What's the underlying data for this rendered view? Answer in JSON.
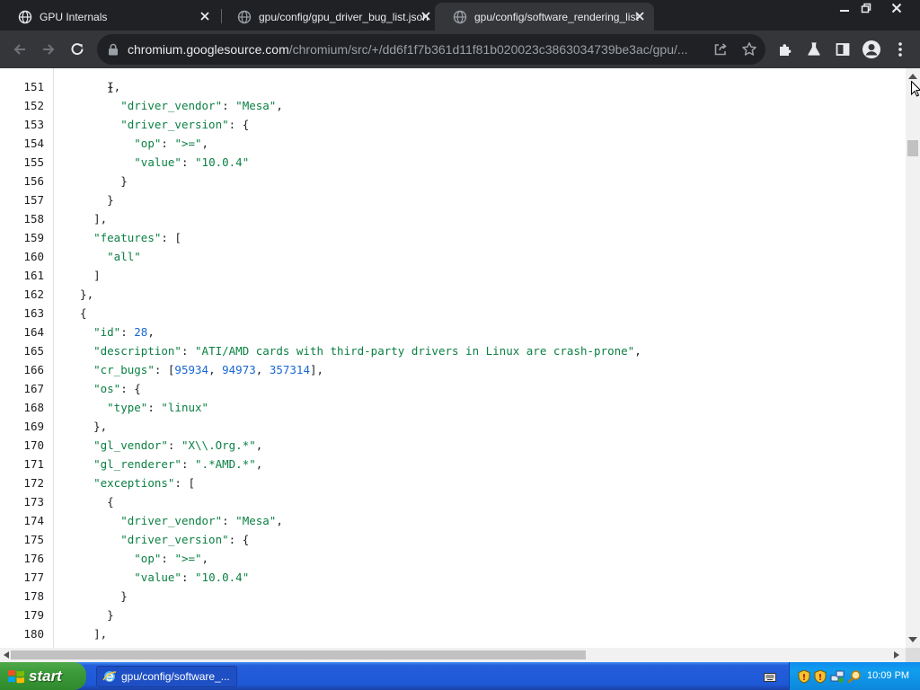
{
  "tabs": [
    {
      "title": "GPU Internals",
      "active": false
    },
    {
      "title": "gpu/config/gpu_driver_bug_list.json",
      "active": false
    },
    {
      "title": "gpu/config/software_rendering_list",
      "active": true
    }
  ],
  "omnibox": {
    "host": "chromium.googlesource.com",
    "path": "/chromium/src/+/dd6f1f7b361d11f81b020023c3863034739be3ac/gpu/..."
  },
  "code_lines": [
    {
      "num": "151",
      "text": "      {"
    },
    {
      "num": "152",
      "text": "        \"driver_vendor\": \"Mesa\","
    },
    {
      "num": "153",
      "text": "        \"driver_version\": {"
    },
    {
      "num": "154",
      "text": "          \"op\": \">=\","
    },
    {
      "num": "155",
      "text": "          \"value\": \"10.0.4\""
    },
    {
      "num": "156",
      "text": "        }"
    },
    {
      "num": "157",
      "text": "      }"
    },
    {
      "num": "158",
      "text": "    ],"
    },
    {
      "num": "159",
      "text": "    \"features\": ["
    },
    {
      "num": "160",
      "text": "      \"all\""
    },
    {
      "num": "161",
      "text": "    ]"
    },
    {
      "num": "162",
      "text": "  },"
    },
    {
      "num": "163",
      "text": "  {"
    },
    {
      "num": "164",
      "text": "    \"id\": 28,"
    },
    {
      "num": "165",
      "text": "    \"description\": \"ATI/AMD cards with third-party drivers in Linux are crash-prone\","
    },
    {
      "num": "166",
      "text": "    \"cr_bugs\": [95934, 94973, 357314],"
    },
    {
      "num": "167",
      "text": "    \"os\": {"
    },
    {
      "num": "168",
      "text": "      \"type\": \"linux\""
    },
    {
      "num": "169",
      "text": "    },"
    },
    {
      "num": "170",
      "text": "    \"gl_vendor\": \"X\\\\.Org.*\","
    },
    {
      "num": "171",
      "text": "    \"gl_renderer\": \".*AMD.*\","
    },
    {
      "num": "172",
      "text": "    \"exceptions\": ["
    },
    {
      "num": "173",
      "text": "      {"
    },
    {
      "num": "174",
      "text": "        \"driver_vendor\": \"Mesa\","
    },
    {
      "num": "175",
      "text": "        \"driver_version\": {"
    },
    {
      "num": "176",
      "text": "          \"op\": \">=\","
    },
    {
      "num": "177",
      "text": "          \"value\": \"10.0.4\""
    },
    {
      "num": "178",
      "text": "        }"
    },
    {
      "num": "179",
      "text": "      }"
    },
    {
      "num": "180",
      "text": "    ],"
    }
  ],
  "taskbar": {
    "start_label": "start",
    "task_item": "gpu/config/software_...",
    "clock": "10:09 PM"
  },
  "colors": {
    "json_string": "#0b8043",
    "json_number": "#1967d2",
    "chrome_dark": "#202124",
    "toolbar": "#35363a"
  },
  "icons": [
    "globe-icon",
    "close-icon",
    "back-icon",
    "forward-icon",
    "reload-icon",
    "lock-icon",
    "share-icon",
    "star-icon",
    "extensions-icon",
    "labs-icon",
    "sidepanel-icon",
    "profile-icon",
    "menu-icon",
    "windows-logo-icon",
    "ie-icon",
    "keyboard-icon",
    "shield-icon",
    "network-icon",
    "search-icon"
  ]
}
